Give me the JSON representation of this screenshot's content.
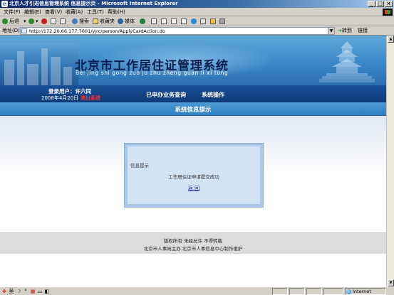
{
  "window": {
    "title": "北京人才引进信息管理系统 信息提示页 - Microsoft Internet Explorer",
    "controls": [
      "_",
      "□",
      "×"
    ]
  },
  "menu": {
    "items": [
      "文件(F)",
      "编辑(E)",
      "查看(V)",
      "收藏(A)",
      "工具(T)",
      "帮助(H)"
    ]
  },
  "toolbar": {
    "back": "后退",
    "search": "搜索",
    "favorites": "收藏夹",
    "media": "媒体"
  },
  "address": {
    "label": "地址(D)",
    "url": "http://172.20.66.177:7001/yjrc/person/ApplyCardAction.do",
    "go": "转到",
    "links": "链接"
  },
  "site": {
    "title": "北京市工作居住证管理系统",
    "pinyin": "Bei jing shi gong zuo ju zhu zheng guan li xi tong"
  },
  "nav": {
    "user": "登录用户：许六同",
    "date": "2008年4月20日",
    "logout": "退出系统",
    "links": [
      "已申办业务查询",
      "系统操作"
    ]
  },
  "section": {
    "title": "系统信息提示"
  },
  "message": {
    "title": "信息提示",
    "body": "工作居住证申请提交成功",
    "back": "返 回"
  },
  "footer": {
    "line1": "版权所有 未经允许 不得转载",
    "line2": "北京市人事局主办 北京市人事信息中心制作维护"
  },
  "status": {
    "ime": "英",
    "zone": "Internet"
  },
  "colors": {
    "nav_bg": "#0e3a78",
    "section_bg": "#2f7fc2",
    "title_text": "#0b1f4e",
    "logout": "#ff3030",
    "msg_border": "#aac8e8"
  }
}
